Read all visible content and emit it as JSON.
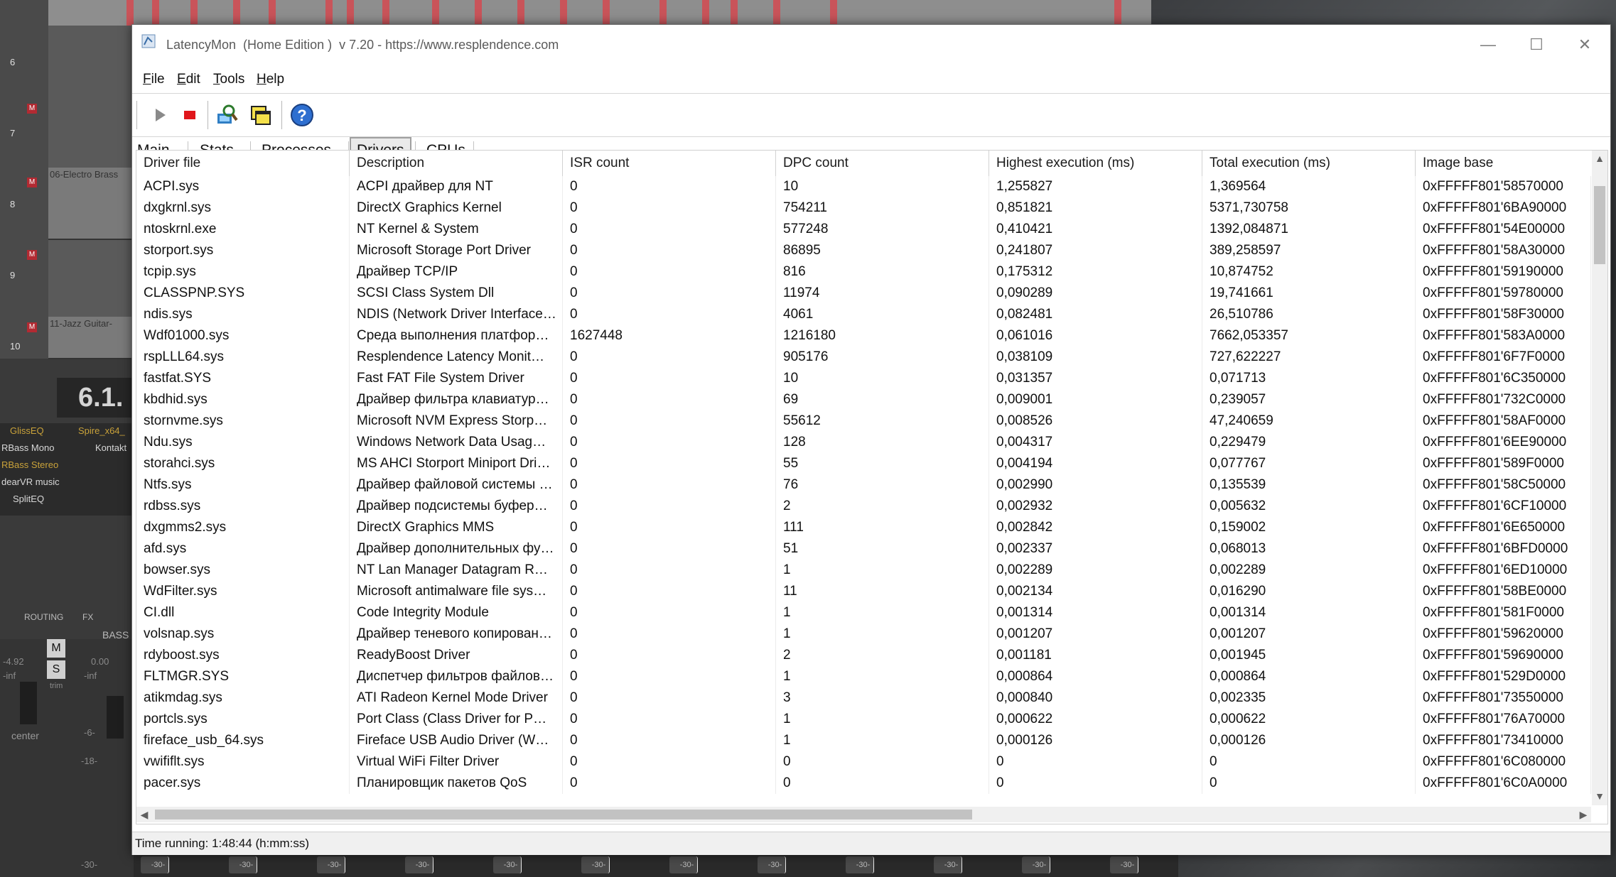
{
  "window": {
    "title": "LatencyMon  (Home Edition )  v 7.20 - https://www.resplendence.com",
    "minimize_glyph": "—",
    "maximize_glyph": "☐",
    "close_glyph": "✕"
  },
  "menu": [
    {
      "key": "F",
      "rest": "ile"
    },
    {
      "key": "E",
      "rest": "dit"
    },
    {
      "key": "T",
      "rest": "ools"
    },
    {
      "key": "H",
      "rest": "elp"
    }
  ],
  "toolbar": {
    "icons": [
      "play-icon",
      "stop-icon",
      "driver-search-icon",
      "windows-icon",
      "help-icon"
    ],
    "help_glyph": "?"
  },
  "tabs": [
    {
      "key": "M",
      "rest": "ain",
      "active": false
    },
    {
      "key": "S",
      "rest": "tats",
      "active": false
    },
    {
      "key": "P",
      "rest": "rocesses",
      "active": false
    },
    {
      "key": "D",
      "rest": "rivers",
      "active": true
    },
    {
      "key": "C",
      "rest": "PUs",
      "active": false
    }
  ],
  "drivers_table": {
    "columns": [
      "Driver file",
      "Description",
      "ISR count",
      "DPC count",
      "Highest execution (ms)",
      "Total execution (ms)",
      "Image base"
    ],
    "rows": [
      [
        "ACPI.sys",
        "ACPI драйвер для NT",
        "0",
        "10",
        "1,255827",
        "1,369564",
        "0xFFFFF801'58570000"
      ],
      [
        "dxgkrnl.sys",
        "DirectX Graphics Kernel",
        "0",
        "754211",
        "0,851821",
        "5371,730758",
        "0xFFFFF801'6BA90000"
      ],
      [
        "ntoskrnl.exe",
        "NT Kernel & System",
        "0",
        "577248",
        "0,410421",
        "1392,084871",
        "0xFFFFF801'54E00000"
      ],
      [
        "storport.sys",
        "Microsoft Storage Port Driver",
        "0",
        "86895",
        "0,241807",
        "389,258597",
        "0xFFFFF801'58A30000"
      ],
      [
        "tcpip.sys",
        "Драйвер TCP/IP",
        "0",
        "816",
        "0,175312",
        "10,874752",
        "0xFFFFF801'59190000"
      ],
      [
        "CLASSPNP.SYS",
        "SCSI Class System Dll",
        "0",
        "11974",
        "0,090289",
        "19,741661",
        "0xFFFFF801'59780000"
      ],
      [
        "ndis.sys",
        "NDIS (Network Driver Interface…",
        "0",
        "4061",
        "0,082481",
        "26,510786",
        "0xFFFFF801'58F30000"
      ],
      [
        "Wdf01000.sys",
        "Среда выполнения платфор…",
        "1627448",
        "1216180",
        "0,061016",
        "7662,053357",
        "0xFFFFF801'583A0000"
      ],
      [
        "rspLLL64.sys",
        "Resplendence Latency Monit…",
        "0",
        "905176",
        "0,038109",
        "727,622227",
        "0xFFFFF801'6F7F0000"
      ],
      [
        "fastfat.SYS",
        "Fast FAT File System Driver",
        "0",
        "10",
        "0,031357",
        "0,071713",
        "0xFFFFF801'6C350000"
      ],
      [
        "kbdhid.sys",
        "Драйвер фильтра клавиатур…",
        "0",
        "69",
        "0,009001",
        "0,239057",
        "0xFFFFF801'732C0000"
      ],
      [
        "stornvme.sys",
        "Microsoft NVM Express Storp…",
        "0",
        "55612",
        "0,008526",
        "47,240659",
        "0xFFFFF801'58AF0000"
      ],
      [
        "Ndu.sys",
        "Windows Network Data Usag…",
        "0",
        "128",
        "0,004317",
        "0,229479",
        "0xFFFFF801'6EE90000"
      ],
      [
        "storahci.sys",
        "MS AHCI Storport Miniport Dri…",
        "0",
        "55",
        "0,004194",
        "0,077767",
        "0xFFFFF801'589F0000"
      ],
      [
        "Ntfs.sys",
        "Драйвер файловой системы …",
        "0",
        "76",
        "0,002990",
        "0,135539",
        "0xFFFFF801'58C50000"
      ],
      [
        "rdbss.sys",
        "Драйвер подсистемы буфер…",
        "0",
        "2",
        "0,002932",
        "0,005632",
        "0xFFFFF801'6CF10000"
      ],
      [
        "dxgmms2.sys",
        "DirectX Graphics MMS",
        "0",
        "111",
        "0,002842",
        "0,159002",
        "0xFFFFF801'6E650000"
      ],
      [
        "afd.sys",
        "Драйвер дополнительных фу…",
        "0",
        "51",
        "0,002337",
        "0,068013",
        "0xFFFFF801'6BFD0000"
      ],
      [
        "bowser.sys",
        "NT Lan Manager Datagram R…",
        "0",
        "1",
        "0,002289",
        "0,002289",
        "0xFFFFF801'6ED10000"
      ],
      [
        "WdFilter.sys",
        "Microsoft antimalware file sys…",
        "0",
        "11",
        "0,002134",
        "0,016290",
        "0xFFFFF801'58BE0000"
      ],
      [
        "CI.dll",
        "Code Integrity Module",
        "0",
        "1",
        "0,001314",
        "0,001314",
        "0xFFFFF801'581F0000"
      ],
      [
        "volsnap.sys",
        "Драйвер теневого копирован…",
        "0",
        "1",
        "0,001207",
        "0,001207",
        "0xFFFFF801'59620000"
      ],
      [
        "rdyboost.sys",
        "ReadyBoost Driver",
        "0",
        "2",
        "0,001181",
        "0,001945",
        "0xFFFFF801'59690000"
      ],
      [
        "FLTMGR.SYS",
        "Диспетчер фильтров файлов…",
        "0",
        "1",
        "0,000864",
        "0,000864",
        "0xFFFFF801'529D0000"
      ],
      [
        "atikmdag.sys",
        "ATI Radeon Kernel Mode Driver",
        "0",
        "3",
        "0,000840",
        "0,002335",
        "0xFFFFF801'73550000"
      ],
      [
        "portcls.sys",
        "Port Class (Class Driver for P…",
        "0",
        "1",
        "0,000622",
        "0,000622",
        "0xFFFFF801'76A70000"
      ],
      [
        "fireface_usb_64.sys",
        "Fireface USB Audio Driver (W…",
        "0",
        "1",
        "0,000126",
        "0,000126",
        "0xFFFFF801'73410000"
      ],
      [
        "vwififlt.sys",
        "Virtual WiFi Filter Driver",
        "0",
        "0",
        "0",
        "0",
        "0xFFFFF801'6C080000"
      ],
      [
        "pacer.sys",
        "Планировщик пакетов QoS",
        "0",
        "0",
        "0",
        "0",
        "0xFFFFF801'6C0A0000"
      ]
    ]
  },
  "status": {
    "text": "Time running: 1:48:44  (h:mm:ss)"
  },
  "background_daw": {
    "track_numbers": [
      "6",
      "7",
      "8",
      "9",
      "10"
    ],
    "mute_label": "M",
    "lane_labels": [
      "06-Electro Brass",
      "11-Jazz Guitar-"
    ],
    "time_display": "6.1.",
    "fx_labels": [
      "GlissEQ",
      "Spire_x64_",
      "RBass Mono",
      "Kontakt",
      "RBass Stereo",
      "dearVR music",
      "SplitEQ"
    ],
    "strip_labels": [
      "ROUTING",
      "FX",
      "BASS",
      "center",
      "trim"
    ],
    "meter_values": [
      "-4.92",
      "0.00",
      "-inf",
      "-6-",
      "-18-",
      "-30-"
    ],
    "button_labels": [
      "M",
      "S"
    ]
  }
}
